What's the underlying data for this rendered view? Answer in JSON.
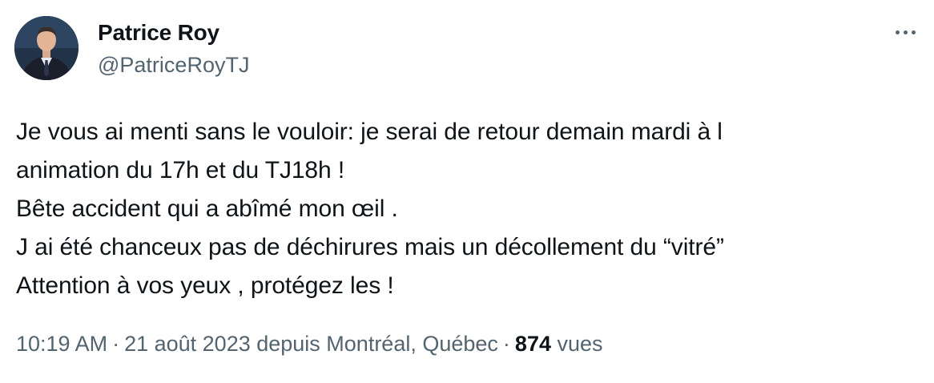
{
  "author": {
    "name": "Patrice Roy",
    "handle": "@PatriceRoyTJ"
  },
  "tweet": {
    "lines": [
      "Je vous ai menti sans le vouloir: je serai de retour demain mardi à l",
      "animation du 17h et du TJ18h !",
      "Bête accident qui a abîmé mon œil .",
      "J ai été chanceux pas de déchirures mais un décollement du “vitré”",
      "Attention à vos yeux , protégez les !"
    ]
  },
  "meta": {
    "time": "10:19 AM",
    "separator": "·",
    "date_location": "21 août 2023 depuis Montréal, Québec",
    "views_count": "874",
    "views_label": "vues"
  },
  "icons": {
    "more": "more-horizontal-icon"
  }
}
